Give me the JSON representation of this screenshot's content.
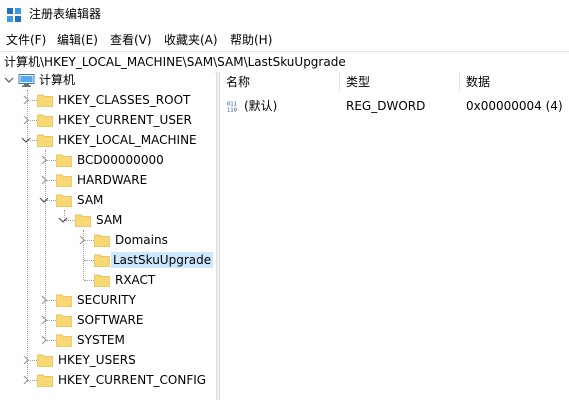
{
  "window": {
    "title": "注册表编辑器"
  },
  "menu": [
    "文件(F)",
    "编辑(E)",
    "查看(V)",
    "收藏夹(A)",
    "帮助(H)"
  ],
  "address": "计算机\\HKEY_LOCAL_MACHINE\\SAM\\SAM\\LastSkuUpgrade",
  "tree": {
    "root": "计算机",
    "hkcr": "HKEY_CLASSES_ROOT",
    "hkcu": "HKEY_CURRENT_USER",
    "hklm": "HKEY_LOCAL_MACHINE",
    "bcd": "BCD00000000",
    "hardware": "HARDWARE",
    "sam": "SAM",
    "sam_sub": "SAM",
    "domains": "Domains",
    "lastsku": "LastSkuUpgrade",
    "rxact": "RXACT",
    "security": "SECURITY",
    "software": "SOFTWARE",
    "system": "SYSTEM",
    "hku": "HKEY_USERS",
    "hkcc": "HKEY_CURRENT_CONFIG"
  },
  "list": {
    "columns": {
      "name": "名称",
      "type": "类型",
      "data": "数据"
    },
    "rows": [
      {
        "name": "(默认)",
        "type": "REG_DWORD",
        "data": "0x00000004 (4)"
      }
    ]
  },
  "icons": {
    "app": "registry-editor-icon",
    "computer": "computer-icon",
    "folder": "folder-icon",
    "value": "binary-value-icon"
  },
  "colors": {
    "selection": "#cce8ff",
    "folder": "#f8d775",
    "accent": "#0078d7"
  }
}
